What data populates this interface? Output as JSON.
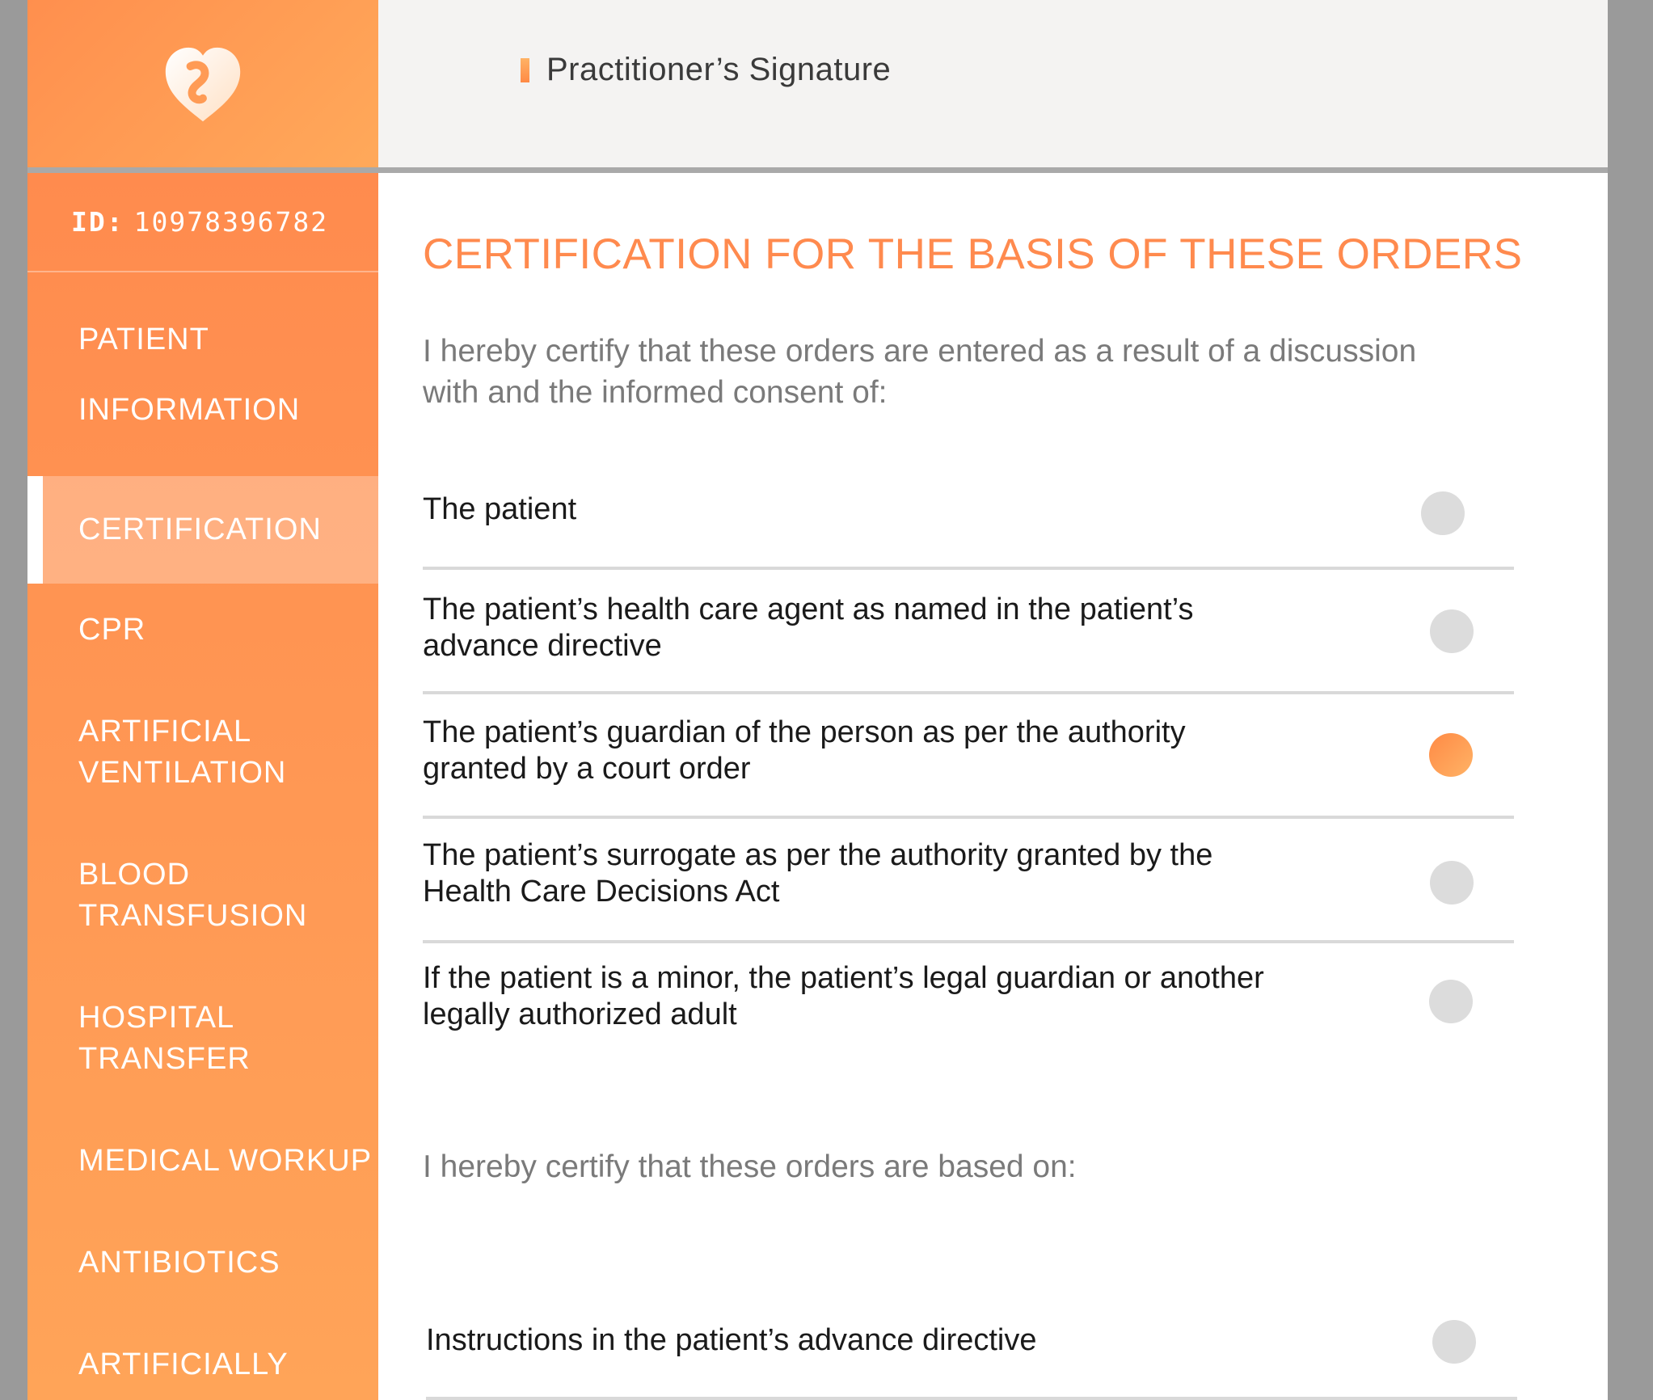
{
  "header": {
    "breadcrumb": "Practitioner’s Signature"
  },
  "sidebar": {
    "id_label": "ID:",
    "id_value": "10978396782",
    "items": [
      {
        "label": "PATIENT"
      },
      {
        "label": "INFORMATION"
      },
      {
        "label": "CERTIFICATION",
        "active": true
      },
      {
        "label": "CPR"
      },
      {
        "label": "ARTIFICIAL VENTILATION"
      },
      {
        "label": "BLOOD TRANSFUSION"
      },
      {
        "label": "HOSPITAL TRANSFER"
      },
      {
        "label": "MEDICAL WORKUP"
      },
      {
        "label": "ANTIBIOTICS"
      },
      {
        "label": "ARTIFICIALLY"
      }
    ]
  },
  "main": {
    "title": "CERTIFICATION FOR THE BASIS OF THESE ORDERS",
    "consent_intro": "I hereby certify that these orders are entered as a result of a discussion with and the informed consent of:",
    "consent_options": [
      {
        "label": "The patient",
        "selected": false
      },
      {
        "label": "The patient’s health care agent as named in the patient’s advance directive",
        "selected": false
      },
      {
        "label": "The patient’s guardian of the person as per the authority granted by a court order",
        "selected": true
      },
      {
        "label": "The patient’s surrogate as per the authority granted by the Health Care Decisions Act",
        "selected": false
      },
      {
        "label": "If the patient is a minor, the patient’s legal guardian or another legally authorized adult",
        "selected": false
      }
    ],
    "basis_intro": "I hereby certify that these orders are based on:",
    "basis_options": [
      {
        "label": "Instructions in the patient’s advance directive",
        "selected": false
      }
    ]
  },
  "colors": {
    "accent": "#ff8a4e",
    "radio_off": "#dcdcdc"
  },
  "icons": {
    "logo": "heart-logo-icon"
  }
}
